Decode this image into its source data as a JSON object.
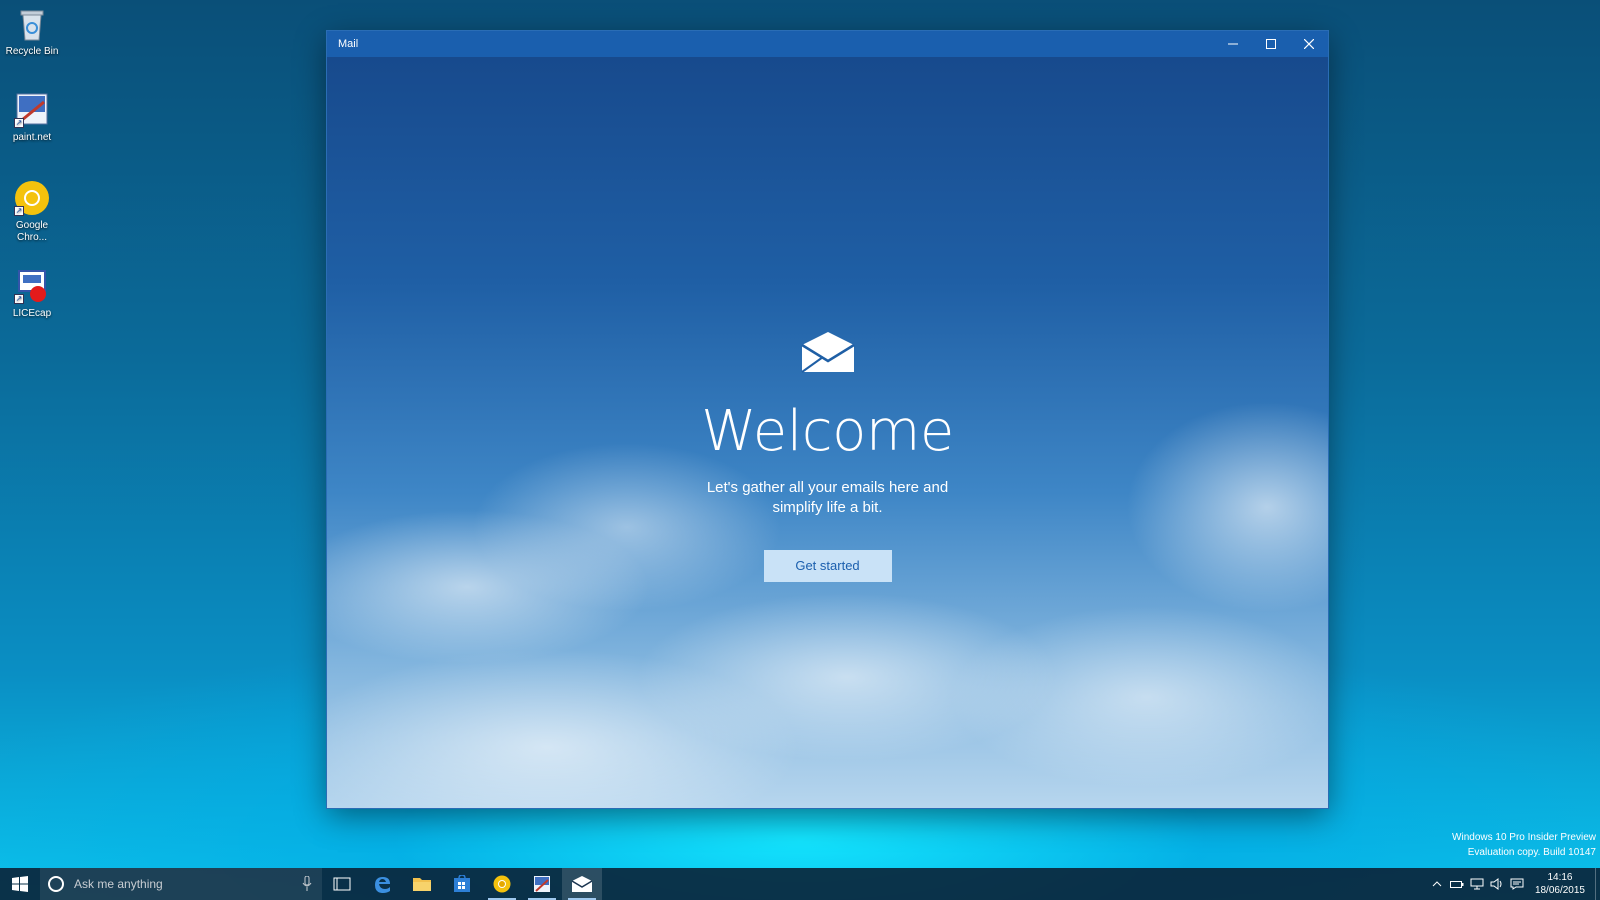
{
  "desktop": {
    "icons": [
      {
        "label": "Recycle Bin",
        "icon": "recycle-bin-icon"
      },
      {
        "label": "paint.net",
        "icon": "paintnet-icon"
      },
      {
        "label": "Google Chro...",
        "icon": "chrome-icon"
      },
      {
        "label": "LICEcap",
        "icon": "licecap-icon"
      }
    ]
  },
  "window": {
    "title": "Mail",
    "controls": {
      "minimize": "minimize-icon",
      "maximize": "maximize-icon",
      "close": "close-icon"
    }
  },
  "welcome": {
    "heading": "Welcome",
    "line1": "Let's gather all your emails here and",
    "line2": "simplify life a bit.",
    "button_label": "Get started"
  },
  "watermark": {
    "line1": "Windows 10 Pro Insider Preview",
    "line2": "Evaluation copy. Build 10147"
  },
  "taskbar": {
    "search_placeholder": "Ask me anything",
    "apps": [
      "task-view-icon",
      "edge-icon",
      "file-explorer-icon",
      "store-icon",
      "chrome-icon",
      "paintnet-icon",
      "mail-icon"
    ],
    "clock": {
      "time": "14:16",
      "date": "18/06/2015"
    }
  },
  "colors": {
    "accent": "#1a5fae",
    "button_bg": "#c9e2f7",
    "button_text": "#1b5fae"
  }
}
